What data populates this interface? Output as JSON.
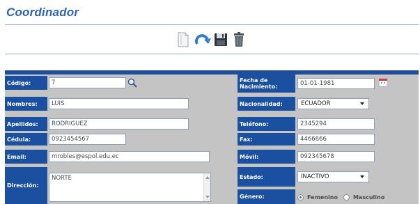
{
  "page": {
    "title": "Coordinador"
  },
  "toolbar": {
    "new_icon": "document-icon",
    "refresh_icon": "refresh-icon",
    "save_icon": "save-icon",
    "delete_icon": "trash-icon"
  },
  "form": {
    "codigo": {
      "label": "Código:",
      "value": "7"
    },
    "nombres": {
      "label": "Nombres:",
      "value": "LUIS"
    },
    "apellidos": {
      "label": "Apellidos:",
      "value": "RODRIGUEZ"
    },
    "cedula": {
      "label": "Cédula:",
      "value": "0923454567"
    },
    "email": {
      "label": "Email:",
      "value": "mrobles@espol.edu.ec"
    },
    "direccion": {
      "label": "Dirección:",
      "value": "NORTE"
    },
    "fecha_nacimiento": {
      "label_line1": "Fecha de",
      "label_line2": "Nacimiento:",
      "value": "01-01-1981"
    },
    "nacionalidad": {
      "label": "Nacionalidad:",
      "value": "ECUADOR"
    },
    "telefono": {
      "label": "Teléfono:",
      "value": "2345294"
    },
    "fax": {
      "label": "Fax:",
      "value": "4466666"
    },
    "movil": {
      "label": "Móvil:",
      "value": "092345678"
    },
    "estado": {
      "label": "Estado:",
      "value": "INACTIVO"
    },
    "genero": {
      "label": "Género:",
      "options": [
        "Femenino",
        "Masculino"
      ],
      "selected": "Femenino"
    }
  },
  "colors": {
    "title": "#2f63b3",
    "label_bg": "#1b4fa0",
    "form_bg": "#c4c4c4"
  }
}
